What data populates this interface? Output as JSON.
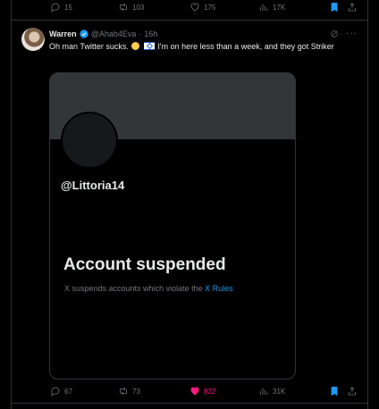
{
  "previous_tweet": {
    "actions": {
      "replies": "15",
      "retweets": "103",
      "likes": "175",
      "views": "17K"
    }
  },
  "tweet": {
    "author_name": "Warren",
    "handle": "@Ahab4Eva",
    "separator": "·",
    "time": "16h",
    "text_before_emoji": "Oh man Twitter sucks.",
    "text_after_emoji": "I'm on here less than a week, and they got Striker",
    "more_icon": "···",
    "media": {
      "username": "@Littoria14",
      "title": "Account suspended",
      "subtitle": "X suspends accounts which violate the",
      "link_text": "X Rules"
    },
    "actions": {
      "replies": "67",
      "retweets": "73",
      "likes": "822",
      "views": "31K"
    }
  },
  "colors": {
    "background": "#000000",
    "text": "#e7e9ea",
    "muted": "#71767b",
    "accent": "#1d9bf0",
    "like": "#f91880"
  },
  "icons": [
    "reply-icon",
    "retweet-icon",
    "like-icon",
    "views-icon",
    "bookmark-icon",
    "share-icon",
    "verified-icon",
    "grok-icon",
    "more-icon"
  ]
}
